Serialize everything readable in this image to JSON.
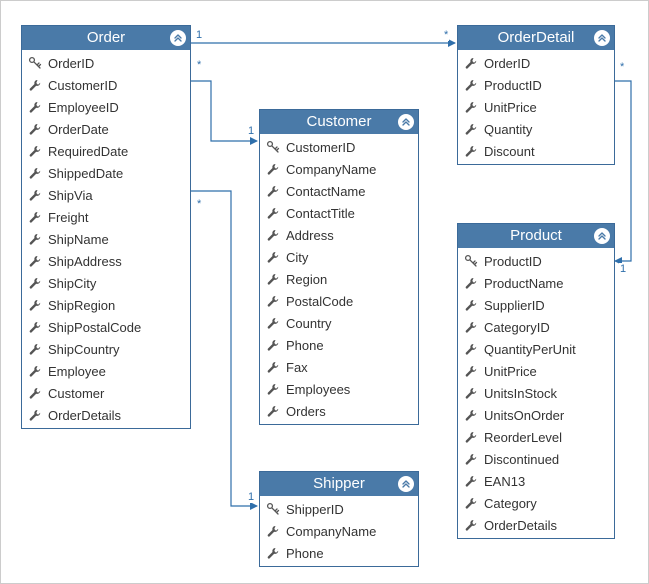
{
  "entities": {
    "order": {
      "title": "Order",
      "attrs": [
        {
          "name": "OrderID",
          "icon": "key"
        },
        {
          "name": "CustomerID",
          "icon": "wrench"
        },
        {
          "name": "EmployeeID",
          "icon": "wrench"
        },
        {
          "name": "OrderDate",
          "icon": "wrench"
        },
        {
          "name": "RequiredDate",
          "icon": "wrench"
        },
        {
          "name": "ShippedDate",
          "icon": "wrench"
        },
        {
          "name": "ShipVia",
          "icon": "wrench"
        },
        {
          "name": "Freight",
          "icon": "wrench"
        },
        {
          "name": "ShipName",
          "icon": "wrench"
        },
        {
          "name": "ShipAddress",
          "icon": "wrench"
        },
        {
          "name": "ShipCity",
          "icon": "wrench"
        },
        {
          "name": "ShipRegion",
          "icon": "wrench"
        },
        {
          "name": "ShipPostalCode",
          "icon": "wrench"
        },
        {
          "name": "ShipCountry",
          "icon": "wrench"
        },
        {
          "name": "Employee",
          "icon": "wrench"
        },
        {
          "name": "Customer",
          "icon": "wrench"
        },
        {
          "name": "OrderDetails",
          "icon": "wrench"
        }
      ]
    },
    "customer": {
      "title": "Customer",
      "attrs": [
        {
          "name": "CustomerID",
          "icon": "key"
        },
        {
          "name": "CompanyName",
          "icon": "wrench"
        },
        {
          "name": "ContactName",
          "icon": "wrench"
        },
        {
          "name": "ContactTitle",
          "icon": "wrench"
        },
        {
          "name": "Address",
          "icon": "wrench"
        },
        {
          "name": "City",
          "icon": "wrench"
        },
        {
          "name": "Region",
          "icon": "wrench"
        },
        {
          "name": "PostalCode",
          "icon": "wrench"
        },
        {
          "name": "Country",
          "icon": "wrench"
        },
        {
          "name": "Phone",
          "icon": "wrench"
        },
        {
          "name": "Fax",
          "icon": "wrench"
        },
        {
          "name": "Employees",
          "icon": "wrench"
        },
        {
          "name": "Orders",
          "icon": "wrench"
        }
      ]
    },
    "shipper": {
      "title": "Shipper",
      "attrs": [
        {
          "name": "ShipperID",
          "icon": "key"
        },
        {
          "name": "CompanyName",
          "icon": "wrench"
        },
        {
          "name": "Phone",
          "icon": "wrench"
        }
      ]
    },
    "orderdetail": {
      "title": "OrderDetail",
      "attrs": [
        {
          "name": "OrderID",
          "icon": "wrench"
        },
        {
          "name": "ProductID",
          "icon": "wrench"
        },
        {
          "name": "UnitPrice",
          "icon": "wrench"
        },
        {
          "name": "Quantity",
          "icon": "wrench"
        },
        {
          "name": "Discount",
          "icon": "wrench"
        }
      ]
    },
    "product": {
      "title": "Product",
      "attrs": [
        {
          "name": "ProductID",
          "icon": "key"
        },
        {
          "name": "ProductName",
          "icon": "wrench"
        },
        {
          "name": "SupplierID",
          "icon": "wrench"
        },
        {
          "name": "CategoryID",
          "icon": "wrench"
        },
        {
          "name": "QuantityPerUnit",
          "icon": "wrench"
        },
        {
          "name": "UnitPrice",
          "icon": "wrench"
        },
        {
          "name": "UnitsInStock",
          "icon": "wrench"
        },
        {
          "name": "UnitsOnOrder",
          "icon": "wrench"
        },
        {
          "name": "ReorderLevel",
          "icon": "wrench"
        },
        {
          "name": "Discontinued",
          "icon": "wrench"
        },
        {
          "name": "EAN13",
          "icon": "wrench"
        },
        {
          "name": "Category",
          "icon": "wrench"
        },
        {
          "name": "OrderDetails",
          "icon": "wrench"
        }
      ]
    }
  },
  "relationships": [
    {
      "from": "Order",
      "to": "OrderDetail",
      "from_card": "1",
      "to_card": "*"
    },
    {
      "from": "Order",
      "to": "Customer",
      "from_card": "*",
      "to_card": "1"
    },
    {
      "from": "Order",
      "to": "Shipper",
      "from_card": "*",
      "to_card": "1"
    },
    {
      "from": "OrderDetail",
      "to": "Product",
      "from_card": "*",
      "to_card": "1"
    }
  ],
  "card_labels": {
    "order_orderdetail_1": "1",
    "order_orderdetail_star": "*",
    "order_customer_star": "*",
    "order_customer_1": "1",
    "order_shipper_star": "*",
    "order_shipper_1": "1",
    "orderdetail_product_star": "*",
    "orderdetail_product_1": "1"
  },
  "colors": {
    "header": "#4a7aa8",
    "border": "#3b6a99",
    "connector": "#2f6fab"
  }
}
